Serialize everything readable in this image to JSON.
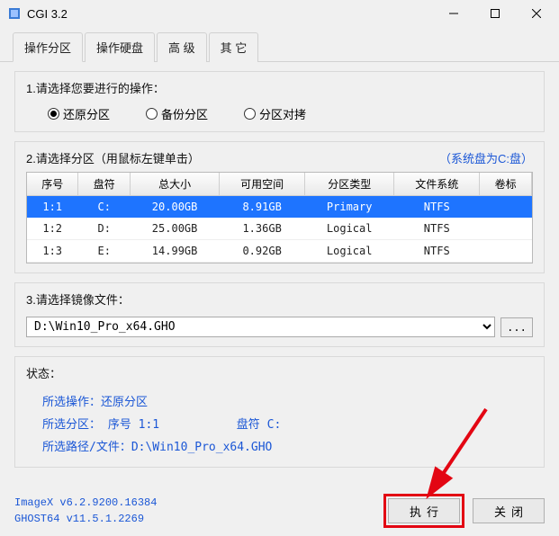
{
  "window": {
    "title": "CGI 3.2"
  },
  "tabs": {
    "t0": "操作分区",
    "t1": "操作硬盘",
    "t2": "高 级",
    "t3": "其 它"
  },
  "section1": {
    "title": "1.请选择您要进行的操作：",
    "opt_restore": "还原分区",
    "opt_backup": "备份分区",
    "opt_copy": "分区对拷"
  },
  "section2": {
    "title": "2.请选择分区（用鼠标左键单击）",
    "sysdisk": "（系统盘为C:盘）",
    "headers": {
      "no": "序号",
      "drive": "盘符",
      "total": "总大小",
      "free": "可用空间",
      "ptype": "分区类型",
      "fs": "文件系统",
      "label": "卷标"
    },
    "rows": [
      {
        "no": "1:1",
        "drive": "C:",
        "total": "20.00GB",
        "free": "8.91GB",
        "ptype": "Primary",
        "fs": "NTFS",
        "label": ""
      },
      {
        "no": "1:2",
        "drive": "D:",
        "total": "25.00GB",
        "free": "1.36GB",
        "ptype": "Logical",
        "fs": "NTFS",
        "label": ""
      },
      {
        "no": "1:3",
        "drive": "E:",
        "total": "14.99GB",
        "free": "0.92GB",
        "ptype": "Logical",
        "fs": "NTFS",
        "label": ""
      }
    ]
  },
  "section3": {
    "title": "3.请选择镜像文件：",
    "path": "D:\\Win10_Pro_x64.GHO",
    "browse": "..."
  },
  "status": {
    "title": "状态：",
    "l1": "所选操作：还原分区",
    "l2a": "所选分区： 序号 1:1",
    "l2b": "盘符 C:",
    "l3": "所选路径/文件：D:\\Win10_Pro_x64.GHO"
  },
  "versions": {
    "imagex": "ImageX v6.2.9200.16384",
    "ghost": "GHOST64 v11.5.1.2269"
  },
  "buttons": {
    "execute": "执行",
    "close": "关闭"
  }
}
